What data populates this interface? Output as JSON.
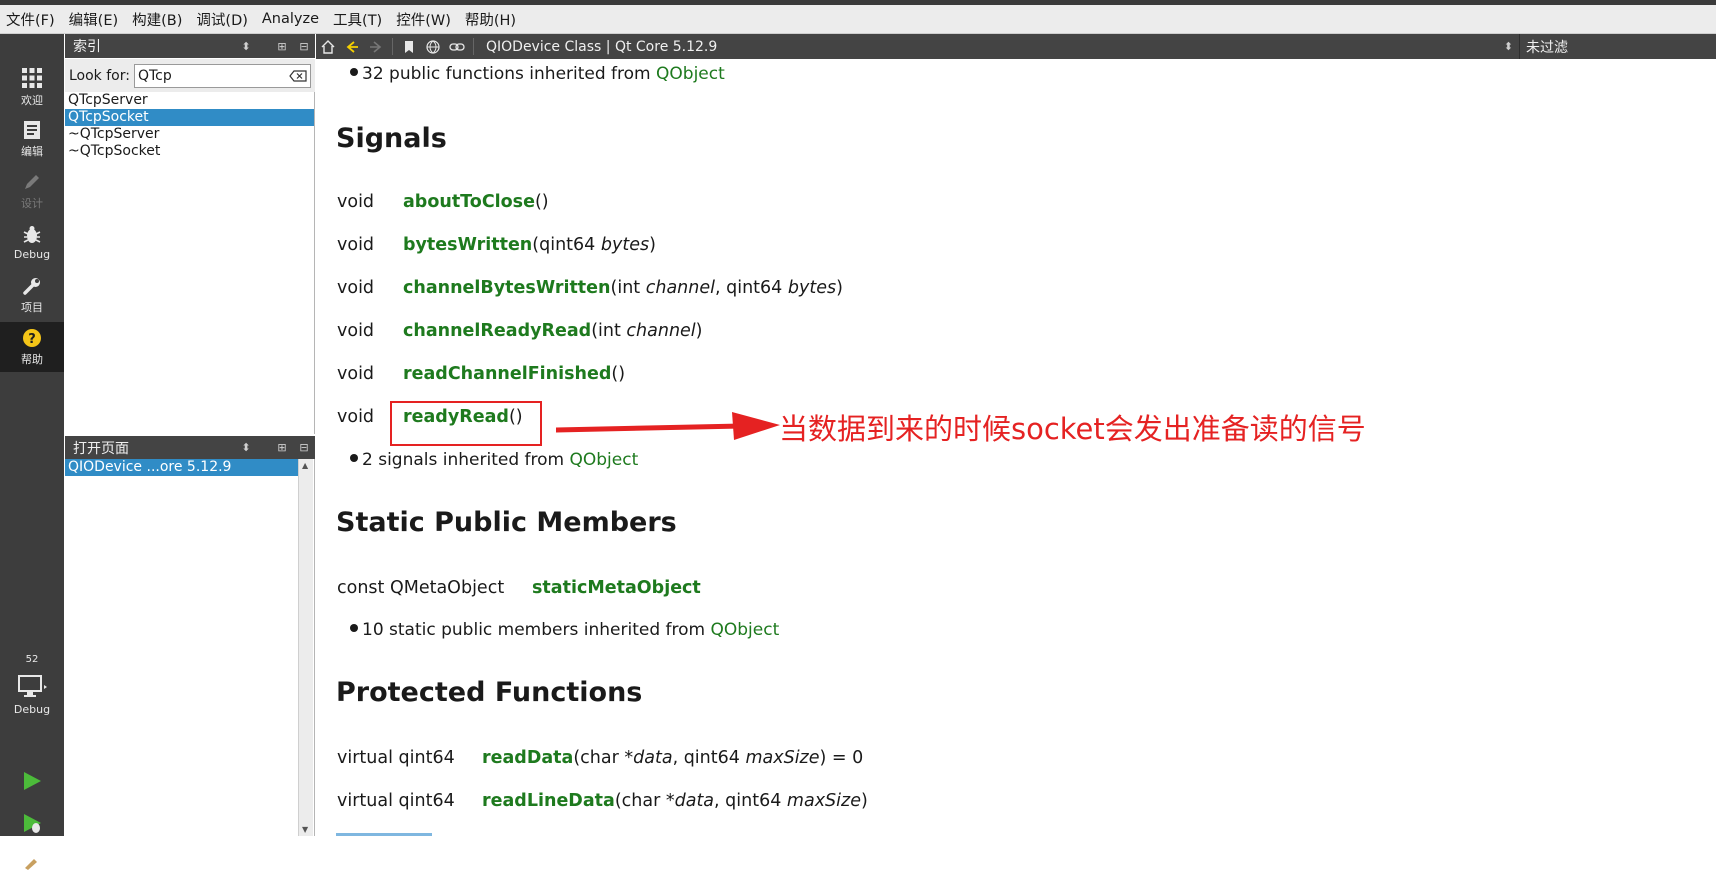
{
  "menubar": [
    "文件(F)",
    "编辑(E)",
    "构建(B)",
    "调试(D)",
    "Analyze",
    "工具(T)",
    "控件(W)",
    "帮助(H)"
  ],
  "modes": {
    "welcome": "欢迎",
    "edit": "编辑",
    "design": "设计",
    "debug": "Debug",
    "projects": "项目",
    "help": "帮助",
    "kit_number": "52",
    "kit_label": "Debug"
  },
  "index_pane": {
    "title": "索引",
    "look_for_label": "Look for:",
    "search_value": "QTcp",
    "items": [
      "QTcpServer",
      "QTcpSocket",
      "~QTcpServer",
      "~QTcpSocket"
    ],
    "selected_index": 1
  },
  "open_pages": {
    "title": "打开页面",
    "items": [
      "QIODevice ...ore 5.12.9"
    ]
  },
  "doc_toolbar": {
    "title": "QIODevice Class | Qt Core 5.12.9",
    "filter": "未过滤"
  },
  "doc": {
    "inherited_functions": {
      "text": "32 public functions inherited from ",
      "link": "QObject"
    },
    "signals_heading": "Signals",
    "signals": [
      {
        "ret": "void",
        "name": "aboutToClose",
        "args": "()"
      },
      {
        "ret": "void",
        "name": "bytesWritten",
        "pre": "(qint64 ",
        "it": "bytes",
        "post": ")"
      },
      {
        "ret": "void",
        "name": "channelBytesWritten",
        "pre": "(int ",
        "it": "channel",
        "mid": ", qint64 ",
        "it2": "bytes",
        "post": ")"
      },
      {
        "ret": "void",
        "name": "channelReadyRead",
        "pre": "(int ",
        "it": "channel",
        "post": ")"
      },
      {
        "ret": "void",
        "name": "readChannelFinished",
        "args": "()"
      },
      {
        "ret": "void",
        "name": "readyRead",
        "args": "()"
      }
    ],
    "inherited_signals": {
      "text": "2 signals inherited from ",
      "link": "QObject"
    },
    "static_heading": "Static Public Members",
    "static_member": {
      "ret": "const QMetaObject",
      "name": "staticMetaObject"
    },
    "inherited_static": {
      "text": "10 static public members inherited from ",
      "link": "QObject"
    },
    "protected_heading": "Protected Functions",
    "protected": [
      {
        "ret": "virtual qint64",
        "name": "readData",
        "pre": "(char *",
        "it": "data",
        "mid": ", qint64 ",
        "it2": "maxSize",
        "post": ") = 0"
      },
      {
        "ret": "virtual qint64",
        "name": "readLineData",
        "pre": "(char *",
        "it": "data",
        "mid": ", qint64 ",
        "it2": "maxSize",
        "post": ")"
      }
    ],
    "annotation": "当数据到来的时候socket会发出准备读的信号"
  },
  "colors": {
    "link": "#1e7a1e",
    "annotation": "#e52222",
    "selection": "#308cc6"
  }
}
